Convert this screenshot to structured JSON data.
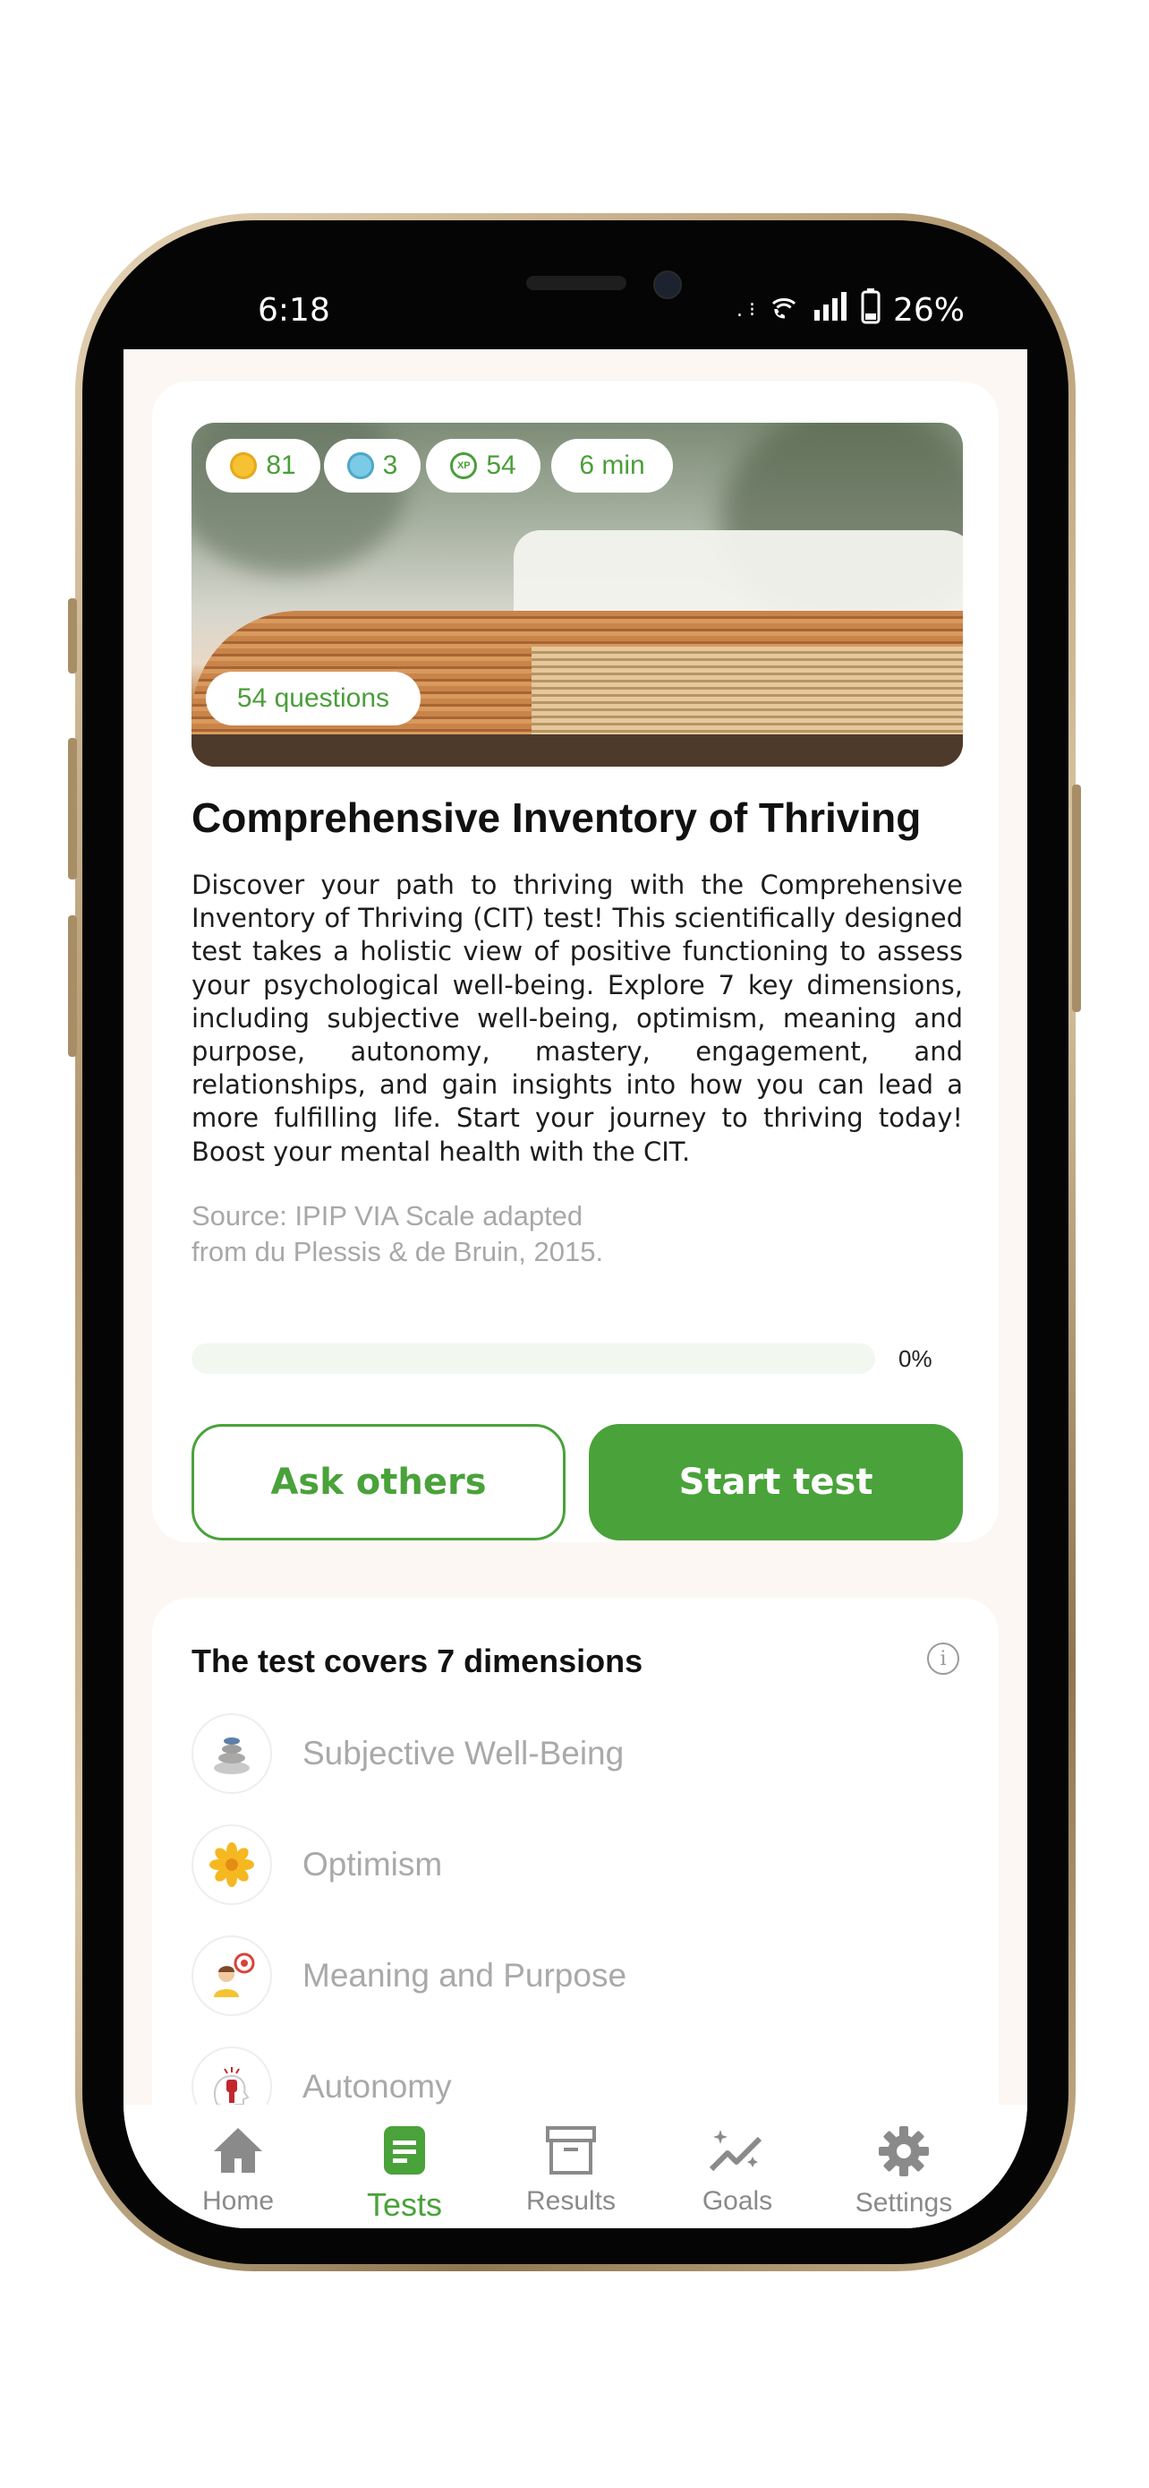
{
  "status_bar": {
    "time": "6:18",
    "indicators": ". ⁝",
    "battery": "26%"
  },
  "test": {
    "stats": {
      "coins": "81",
      "gems": "3",
      "xp_badge": "XP",
      "xp": "54",
      "duration": "6 min"
    },
    "questions": "54 questions",
    "title": "Comprehensive Inventory of Thriving",
    "description": "Discover your path to thriving with the Comprehensive Inventory of Thriving (CIT) test! This scientifically designed test takes a holistic view of positive functioning to assess your psychological well-being. Explore 7 key dimensions, including subjective well-being, optimism, meaning and purpose, autonomy, mastery, engagement, and relationships, and gain insights into how you can lead a more fulfilling life. Start your journey to thriving today! Boost your mental health with the CIT.",
    "source_line1": "Source: IPIP VIA Scale adapted",
    "source_line2": "from du Plessis & de Bruin, 2015.",
    "progress_value": 0,
    "progress_label": "0%",
    "ask_button": "Ask others",
    "start_button": "Start test"
  },
  "dimensions": {
    "heading": "The test covers 7 dimensions",
    "info_icon": "i",
    "items": [
      {
        "label": "Subjective Well-Being",
        "icon": "stones-icon"
      },
      {
        "label": "Optimism",
        "icon": "flower-icon"
      },
      {
        "label": "Meaning and Purpose",
        "icon": "target-person-icon"
      },
      {
        "label": "Autonomy",
        "icon": "head-fist-icon"
      }
    ]
  },
  "tabbar": {
    "items": [
      {
        "label": "Home",
        "icon": "home-icon"
      },
      {
        "label": "Tests",
        "icon": "document-icon"
      },
      {
        "label": "Results",
        "icon": "archive-box-icon"
      },
      {
        "label": "Goals",
        "icon": "sparkle-chart-icon"
      },
      {
        "label": "Settings",
        "icon": "gear-icon"
      }
    ],
    "active": "Tests"
  },
  "colors": {
    "accent": "#4aa23a",
    "background": "#fcf7f2",
    "muted_text": "#a9a9a9"
  }
}
